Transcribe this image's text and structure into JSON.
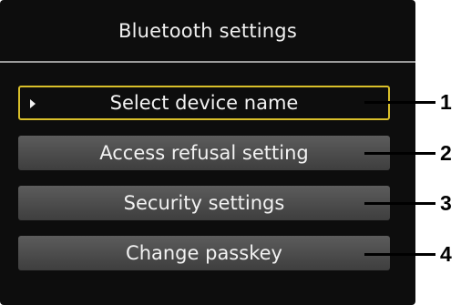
{
  "screen": {
    "title": "Bluetooth settings"
  },
  "menu": {
    "items": [
      {
        "label": "Select device name",
        "selected": true
      },
      {
        "label": "Access refusal setting",
        "selected": false
      },
      {
        "label": "Security settings",
        "selected": false
      },
      {
        "label": "Change passkey",
        "selected": false
      }
    ],
    "cursor_icon": "triangle-right-icon"
  },
  "callouts": [
    "1",
    "2",
    "3",
    "4"
  ],
  "colors": {
    "screen_background": "#0d0d0d",
    "button_fill": "#4a4a4a",
    "selection_border": "#d9bf2a",
    "text": "#f2f2f2"
  }
}
